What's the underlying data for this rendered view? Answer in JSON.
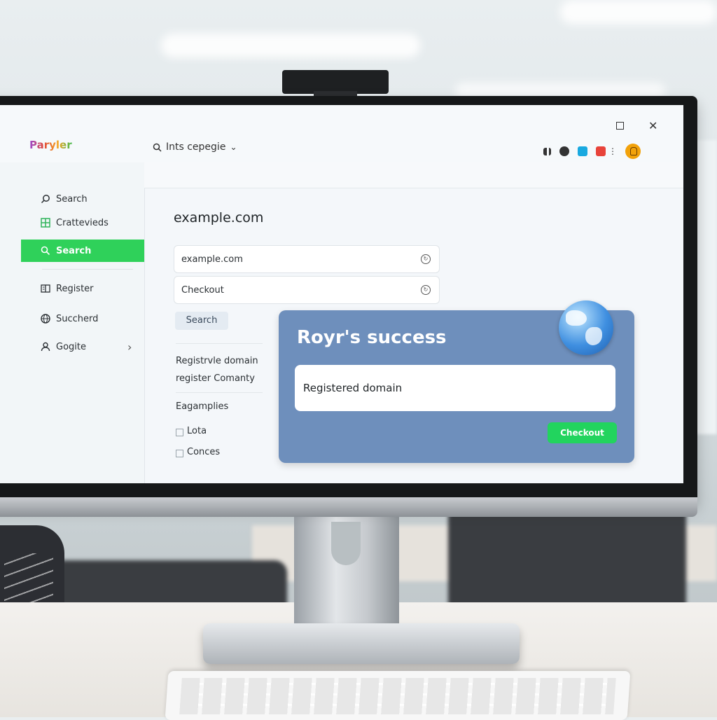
{
  "app": {
    "logo": "Paryler"
  },
  "topbar": {
    "search_text": "Ints cepegie",
    "chevron": "⌄"
  },
  "window": {
    "close_glyph": "✕"
  },
  "sidebar": {
    "items": [
      {
        "label": "Search",
        "icon": "search-icon"
      },
      {
        "label": "Crattevieds",
        "icon": "grid-icon"
      },
      {
        "label": "Search",
        "icon": "search-icon",
        "active": true
      },
      {
        "label": "Register",
        "icon": "register-icon"
      },
      {
        "label": "Succherd",
        "icon": "globe-icon"
      },
      {
        "label": "Gogite",
        "icon": "user-icon",
        "chevron": "›"
      }
    ]
  },
  "main": {
    "title": "example.com",
    "domain_field": {
      "value": "example.com"
    },
    "checkout_field": {
      "value": "Checkout"
    },
    "search_button": "Search",
    "links": [
      "Registrvle domain",
      "register Comanty"
    ],
    "examples_heading": "Eagamplies",
    "options": [
      "Lota",
      "Conces"
    ]
  },
  "success_card": {
    "title": "Royr's success",
    "field_value": "Registered domain",
    "button_label": "Checkout"
  },
  "colors": {
    "accent_green": "#2fd15a",
    "card_blue": "#6e8fbc",
    "avatar": "#f2a20a"
  }
}
